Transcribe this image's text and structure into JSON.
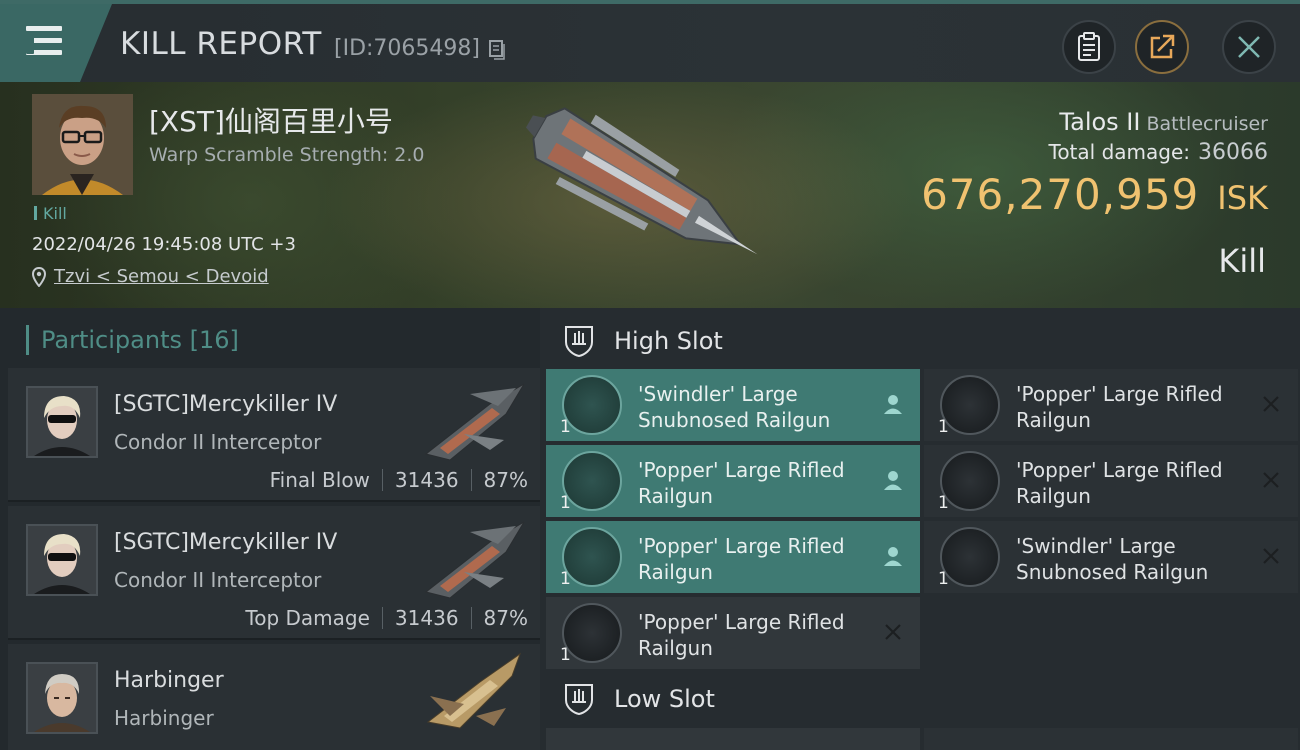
{
  "header": {
    "title": "KILL REPORT",
    "report_id": "[ID:7065498]"
  },
  "victim": {
    "name": "[XST]仙阁百里小号",
    "warp_scramble": "Warp Scramble Strength: 2.0",
    "kill_tag": "Kill",
    "timestamp": "2022/04/26 19:45:08 UTC +3",
    "location": "Tzvi < Semou < Devoid",
    "ship": "Talos II",
    "ship_class": "Battlecruiser",
    "total_damage_label": "Total damage:",
    "total_damage": "36066",
    "isk_value": "676,270,959",
    "isk_unit": "ISK",
    "result": "Kill"
  },
  "participants": {
    "title": "Participants",
    "count": "[16]",
    "rows": [
      {
        "name": "[SGTC]Mercykiller IV",
        "ship": "Condor II Interceptor",
        "role": "Final Blow",
        "damage": "31436",
        "percent": "87%"
      },
      {
        "name": "[SGTC]Mercykiller IV",
        "ship": "Condor II Interceptor",
        "role": "Top Damage",
        "damage": "31436",
        "percent": "87%"
      },
      {
        "name": "Harbinger",
        "ship": "Harbinger",
        "role": "",
        "damage": "",
        "percent": ""
      }
    ]
  },
  "fitting": {
    "high_slot_title": "High Slot",
    "low_slot_title": "Low Slot",
    "high_slot": [
      {
        "name": "'Swindler' Large Snubnosed Railgun",
        "qty": "1",
        "state": "user-icon"
      },
      {
        "name": "'Popper' Large Rifled Railgun",
        "qty": "1",
        "state": "close-icon"
      },
      {
        "name": "'Popper' Large Rifled Railgun",
        "qty": "1",
        "state": "user-icon"
      },
      {
        "name": "'Popper' Large Rifled Railgun",
        "qty": "1",
        "state": "close-icon"
      },
      {
        "name": "'Popper' Large Rifled Railgun",
        "qty": "1",
        "state": "user-icon"
      },
      {
        "name": "'Swindler' Large Snubnosed Railgun",
        "qty": "1",
        "state": "close-icon"
      },
      {
        "name": "'Popper' Large Rifled Railgun",
        "qty": "1",
        "state": "close-icon"
      }
    ]
  },
  "colors": {
    "accent_teal": "#3f7a73",
    "isk_gold": "#f0c270",
    "header_teal": "#3a6864"
  }
}
